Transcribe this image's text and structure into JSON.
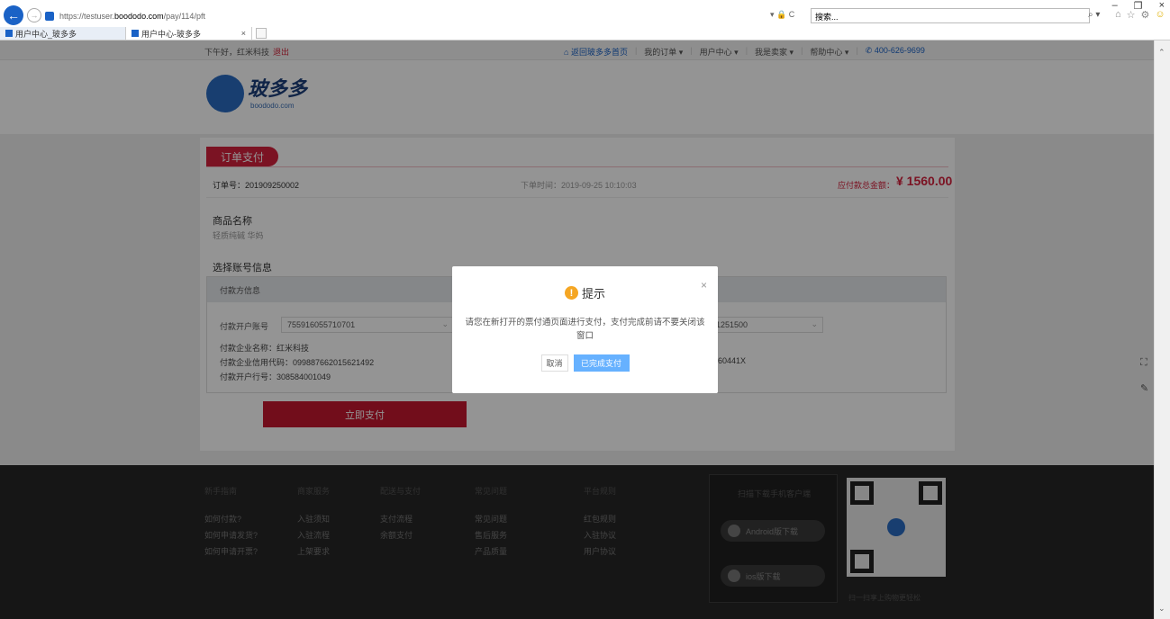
{
  "browser": {
    "window_controls": [
      "–",
      "❐",
      "×"
    ],
    "url_prefix": "https://testuser.",
    "url_domain": "boododo.com",
    "url_path": "/pay/114/pft",
    "addr_right": "▾ 🔒 C",
    "search_placeholder": "搜索...",
    "search_glyph": "⌕ ▾",
    "tabs": [
      {
        "label": "用户中心_玻多多"
      },
      {
        "label": "用户中心-玻多多",
        "close": "×"
      }
    ]
  },
  "topbar": {
    "greeting": "下午好，红米科技",
    "logout": "退出",
    "nav": [
      {
        "label": "返回玻多多首页"
      },
      {
        "label": "我的订单 ▾"
      },
      {
        "label": "用户中心 ▾"
      },
      {
        "label": "我是卖家 ▾"
      },
      {
        "label": "帮助中心 ▾"
      }
    ],
    "phone": "400-626-9699"
  },
  "logo": {
    "mark": "玻",
    "text": "玻多多",
    "sub": "boododo.com"
  },
  "order": {
    "title": "订单支付",
    "order_no": "订单号：201909250002",
    "order_time": "下单时间：2019-09-25 10:10:03",
    "amount_label": "应付款总金额：",
    "amount": "¥ 1560.00",
    "product_section": "商品名称",
    "product_name": "轻质纯碱 华妈",
    "account_section": "选择账号信息",
    "payer_head": "付款方信息",
    "payer_account_label": "付款开户账号",
    "payer_account": "755916055710701",
    "right_account": "1251500",
    "payer_company": "付款企业名称：红米科技",
    "payer_credit": "付款企业信用代码：099887662015621492",
    "payer_bank": "付款开户行号：308584001049",
    "right_credit": "060441X",
    "pay_button": "立即支付"
  },
  "footer": {
    "cols": [
      {
        "head": "新手指南",
        "items": [
          "如何付款?",
          "如何申请发货?",
          "如何申请开票?"
        ]
      },
      {
        "head": "商家服务",
        "items": [
          "入驻须知",
          "入驻流程",
          "上架要求"
        ]
      },
      {
        "head": "配送与支付",
        "items": [
          "支付流程",
          "余额支付"
        ]
      },
      {
        "head": "常见问题",
        "items": [
          "常见问题",
          "售后服务",
          "产品质量"
        ]
      },
      {
        "head": "平台规则",
        "items": [
          "红包规则",
          "入驻协议",
          "用户协议"
        ]
      }
    ],
    "app_head": "扫描下载手机客户端",
    "android": "Android版下载",
    "ios": "ios版下载",
    "qr_caption": "扫一扫享上购物更轻松"
  },
  "modal": {
    "title": "提示",
    "icon": "!",
    "message": "请您在新打开的票付通页面进行支付，支付完成前请不要关闭该窗口",
    "cancel": "取消",
    "confirm": "已完成支付",
    "close": "×"
  }
}
